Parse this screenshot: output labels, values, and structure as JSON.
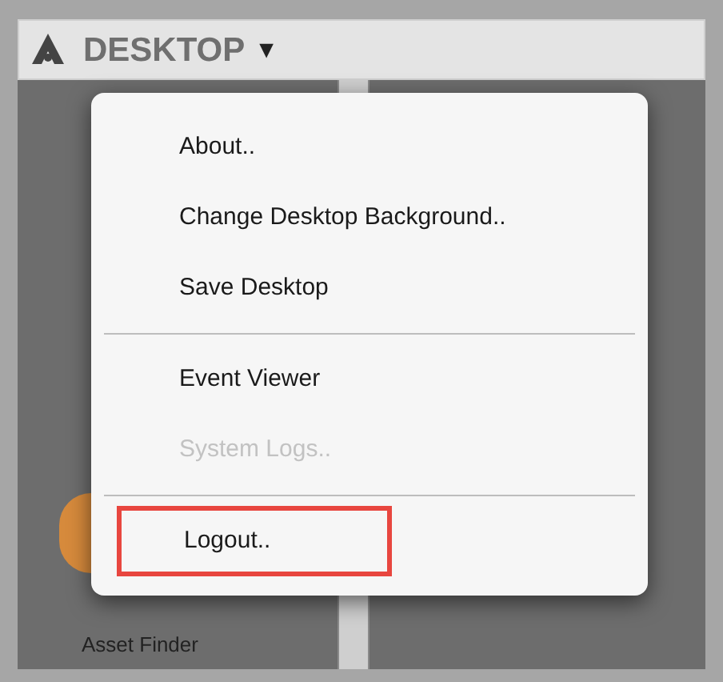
{
  "top_bar": {
    "title": "DESKTOP",
    "caret": "▼"
  },
  "menu": {
    "groups": [
      [
        {
          "label": "About..",
          "disabled": false,
          "highlighted": false
        },
        {
          "label": "Change Desktop Background..",
          "disabled": false,
          "highlighted": false
        },
        {
          "label": "Save Desktop",
          "disabled": false,
          "highlighted": false
        }
      ],
      [
        {
          "label": "Event Viewer",
          "disabled": false,
          "highlighted": false
        },
        {
          "label": "System Logs..",
          "disabled": true,
          "highlighted": false
        }
      ],
      [
        {
          "label": "Logout..",
          "disabled": false,
          "highlighted": true
        }
      ]
    ]
  },
  "desktop_icons": [
    {
      "label": "Asset Finder"
    }
  ]
}
